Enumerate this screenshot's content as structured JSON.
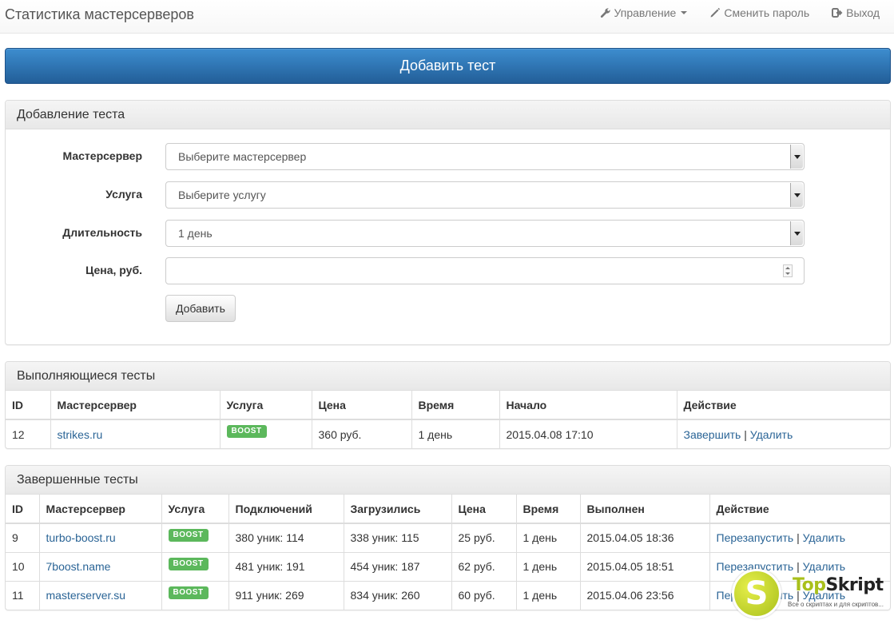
{
  "navbar": {
    "brand": "Статистика мастерсерверов",
    "items": [
      {
        "label": "Управление",
        "icon": "wrench-icon",
        "dropdown": true
      },
      {
        "label": "Сменить пароль",
        "icon": "pencil-icon",
        "dropdown": false
      },
      {
        "label": "Выход",
        "icon": "logout-icon",
        "dropdown": false
      }
    ]
  },
  "add_test_button": "Добавить тест",
  "add_form": {
    "heading": "Добавление теста",
    "fields": {
      "masterserver": {
        "label": "Мастерсервер",
        "value": "Выберите мастерсервер"
      },
      "service": {
        "label": "Услуга",
        "value": "Выберите услугу"
      },
      "duration": {
        "label": "Длительность",
        "value": "1 день"
      },
      "price": {
        "label": "Цена, руб.",
        "value": ""
      }
    },
    "submit": "Добавить"
  },
  "running": {
    "heading": "Выполняющиеся тесты",
    "columns": [
      "ID",
      "Мастерсервер",
      "Услуга",
      "Цена",
      "Время",
      "Начало",
      "Действие"
    ],
    "rows": [
      {
        "id": "12",
        "server": "strikes.ru",
        "service": "BOOST",
        "price": "360 руб.",
        "time": "1 день",
        "start": "2015.04.08 17:10",
        "actions": [
          "Завершить",
          "Удалить"
        ]
      }
    ]
  },
  "finished": {
    "heading": "Завершенные тесты",
    "columns": [
      "ID",
      "Мастерсервер",
      "Услуга",
      "Подключений",
      "Загрузились",
      "Цена",
      "Время",
      "Выполнен",
      "Действие"
    ],
    "rows": [
      {
        "id": "9",
        "server": "turbo-boost.ru",
        "service": "BOOST",
        "connections": "380 уник: 114",
        "loaded": "338 уник: 115",
        "price": "25 руб.",
        "time": "1 день",
        "done": "2015.04.05 18:36",
        "actions": [
          "Перезапустить",
          "Удалить"
        ]
      },
      {
        "id": "10",
        "server": "7boost.name",
        "service": "BOOST",
        "connections": "481 уник: 191",
        "loaded": "454 уник: 187",
        "price": "62 руб.",
        "time": "1 день",
        "done": "2015.04.05 18:51",
        "actions": [
          "Перезапустить",
          "Удалить"
        ]
      },
      {
        "id": "11",
        "server": "masterserver.su",
        "service": "BOOST",
        "connections": "911 уник: 269",
        "loaded": "834 уник: 260",
        "price": "60 руб.",
        "time": "1 день",
        "done": "2015.04.06 23:56",
        "actions": [
          "Перезапустить",
          "Удалить"
        ]
      }
    ]
  },
  "watermark": {
    "letter": "S",
    "title_a": "Top",
    "title_b": "Skript",
    "subtitle": "Все о скриптах и для скриптов..."
  },
  "colors": {
    "primary": "#2a6fb0",
    "link": "#2a6496",
    "badge": "#5cb85c",
    "watermark": "#a9c01b"
  }
}
